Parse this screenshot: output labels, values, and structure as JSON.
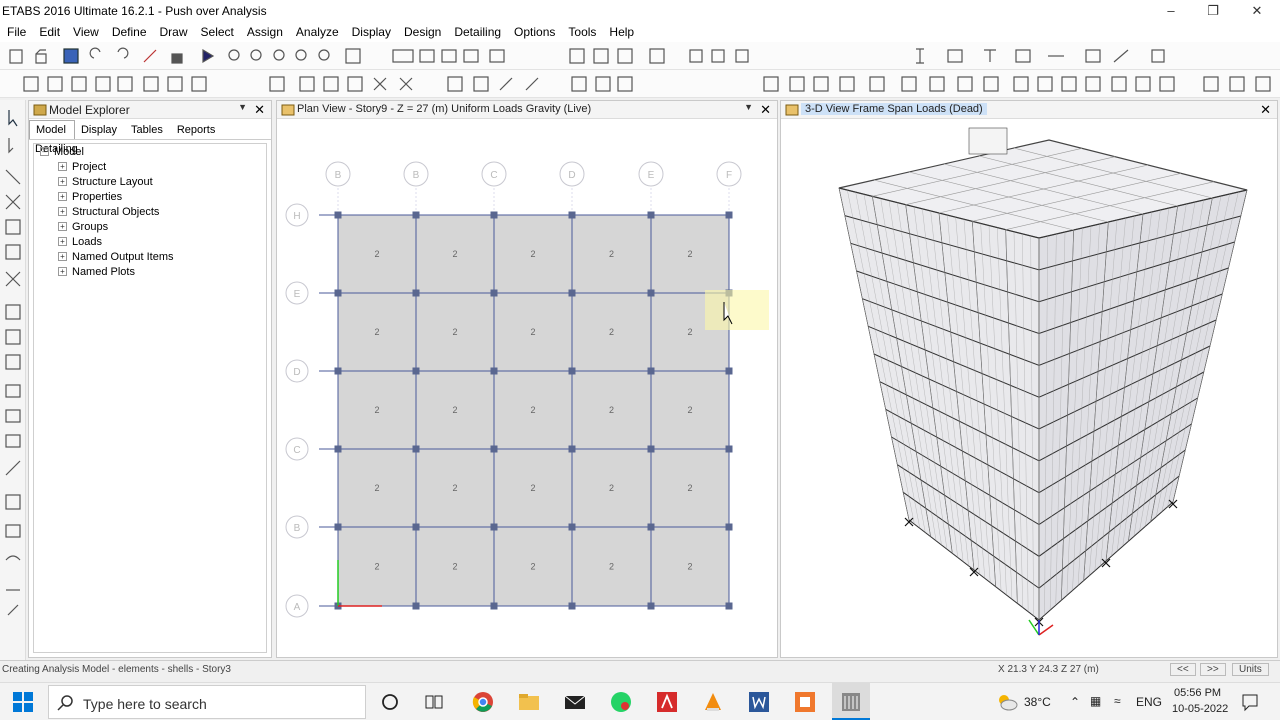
{
  "window": {
    "title": "ETABS 2016 Ultimate 16.2.1 - Push over Analysis"
  },
  "menu": [
    "File",
    "Edit",
    "View",
    "Define",
    "Draw",
    "Select",
    "Assign",
    "Analyze",
    "Display",
    "Design",
    "Detailing",
    "Options",
    "Tools",
    "Help"
  ],
  "model_explorer": {
    "title": "Model Explorer",
    "tabs": [
      "Model",
      "Display",
      "Tables",
      "Reports",
      "Detailing"
    ],
    "root": "Model",
    "items": [
      "Project",
      "Structure Layout",
      "Properties",
      "Structural Objects",
      "Groups",
      "Loads",
      "Named Output Items",
      "Named Plots"
    ]
  },
  "plan_view": {
    "title": "Plan View - Story9 - Z = 27 (m)  Uniform Loads Gravity  (Live)",
    "load_label": "2",
    "column_bubbles": [
      "B",
      "B",
      "C",
      "D",
      "E",
      "F"
    ],
    "row_bubbles": [
      "H",
      "E",
      "D",
      "C",
      "B",
      "A"
    ]
  },
  "view3d": {
    "title": "3-D View  Frame Span Loads (Dead)"
  },
  "status": {
    "message": "Creating Analysis Model - elements - shells - Story3",
    "coords": "X 21.3  Y 24.3  Z 27 (m)",
    "units_button": "Units"
  },
  "taskbar": {
    "search_placeholder": "Type here to search",
    "temperature": "38°C",
    "language": "ENG",
    "time": "05:56 PM",
    "date": "10-05-2022"
  },
  "colors": {
    "grid_line": "#4a5a9a",
    "shell_fill": "#d6d6d6",
    "point": "#5a6790",
    "accent": "#0078d7"
  }
}
